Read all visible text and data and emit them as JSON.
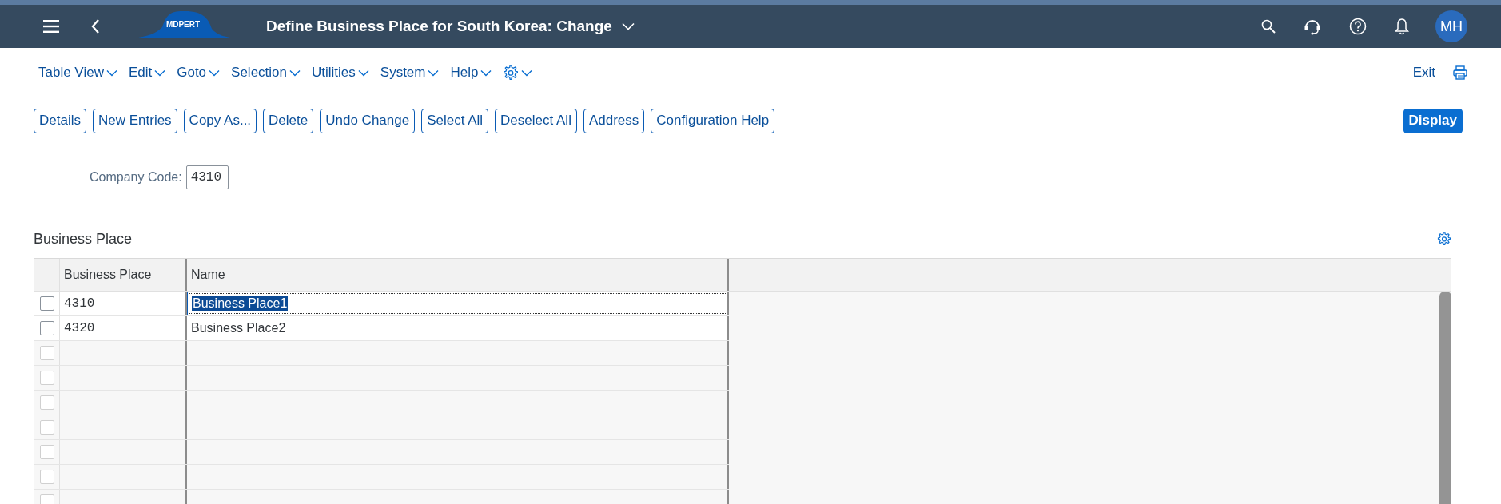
{
  "shell": {
    "logo": "MDPERT",
    "title": "Define Business Place for South Korea: Change",
    "avatar": "MH"
  },
  "menu": [
    "Table View",
    "Edit",
    "Goto",
    "Selection",
    "Utilities",
    "System",
    "Help"
  ],
  "menu_right": {
    "exit": "Exit"
  },
  "buttons": [
    {
      "label": "Details",
      "kind": "outline"
    },
    {
      "label": "New Entries",
      "kind": "outline"
    },
    {
      "label": "Copy As...",
      "kind": "outline"
    },
    {
      "label": "Delete",
      "kind": "outline"
    },
    {
      "label": "Undo Change",
      "kind": "outline"
    },
    {
      "label": "Select All",
      "kind": "outline"
    },
    {
      "label": "Deselect All",
      "kind": "outline"
    },
    {
      "label": "Address",
      "kind": "outline"
    },
    {
      "label": "Configuration Help",
      "kind": "outline"
    },
    {
      "label": "Display",
      "kind": "emphasized"
    }
  ],
  "filter": {
    "label": "Company Code:",
    "value": "4310"
  },
  "table": {
    "title": "Business Place",
    "columns": [
      "Business Place",
      "Name"
    ],
    "rows": [
      {
        "checked": false,
        "disabled": false,
        "business_place": "4310",
        "name": "Business Place1",
        "focused": true
      },
      {
        "checked": false,
        "disabled": false,
        "business_place": "4320",
        "name": "Business Place2",
        "focused": false
      },
      {
        "checked": false,
        "disabled": true
      },
      {
        "checked": false,
        "disabled": true
      },
      {
        "checked": false,
        "disabled": true
      },
      {
        "checked": false,
        "disabled": true
      },
      {
        "checked": false,
        "disabled": true
      },
      {
        "checked": false,
        "disabled": true
      },
      {
        "checked": false,
        "disabled": true
      }
    ]
  }
}
